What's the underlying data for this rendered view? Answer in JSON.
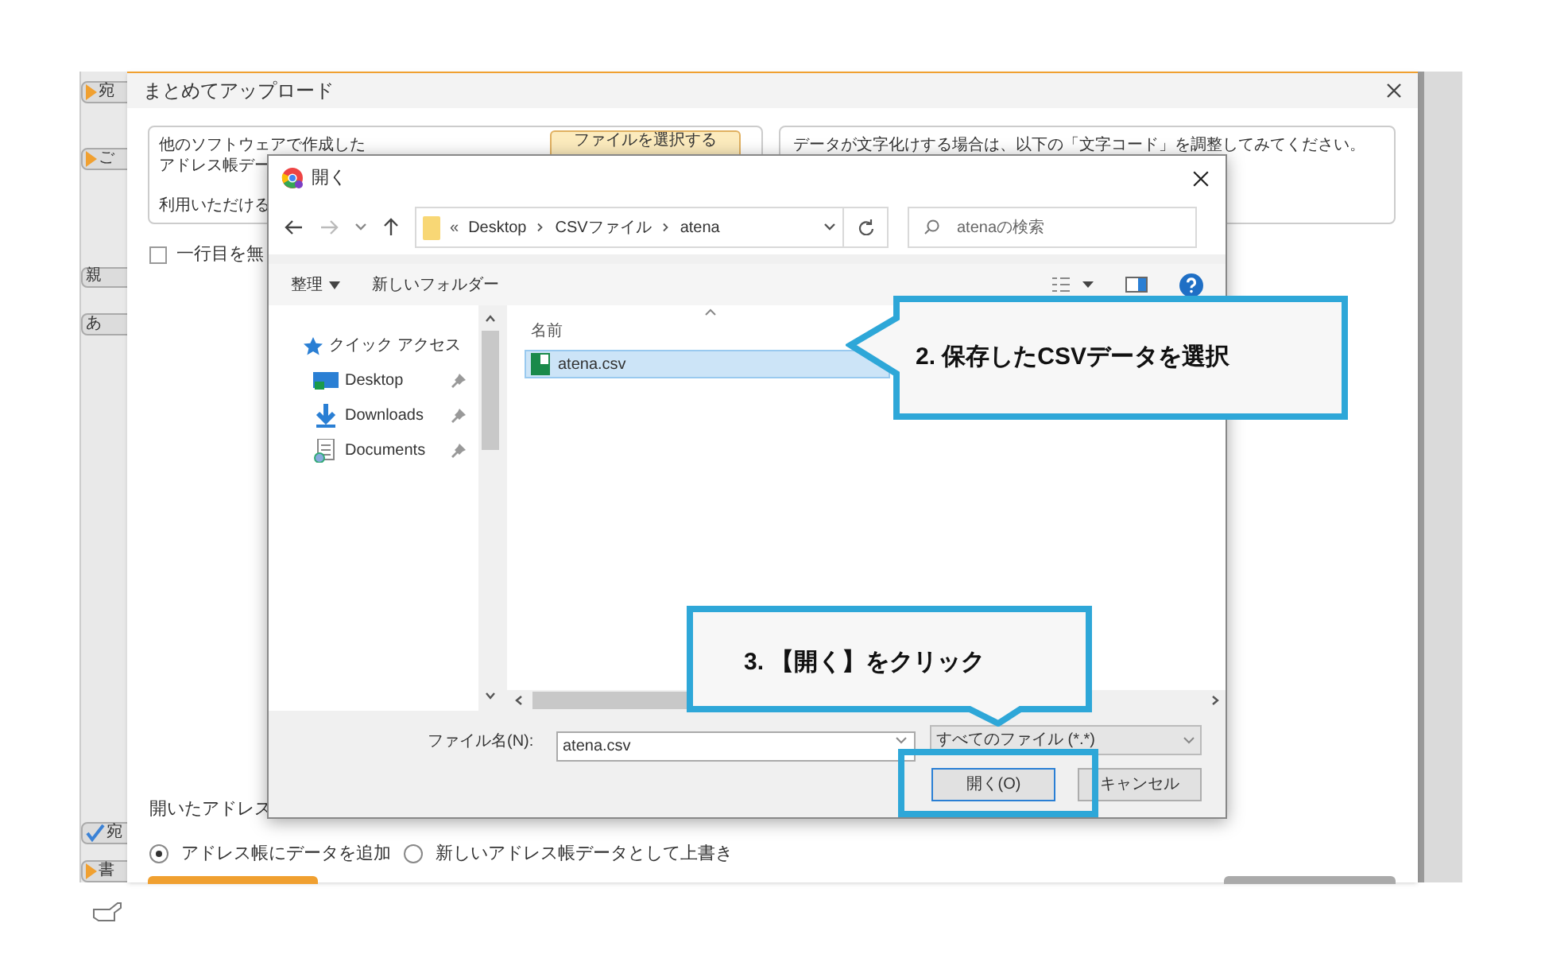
{
  "app_sidebar": {
    "items": [
      {
        "kind": "arrow",
        "label": "宛"
      },
      {
        "kind": "arrow",
        "label": "ご"
      },
      {
        "kind": "plain",
        "label": "親"
      },
      {
        "kind": "plain",
        "label": "あ"
      },
      {
        "kind": "check",
        "label": "宛"
      },
      {
        "kind": "arrow",
        "label": "書"
      }
    ]
  },
  "upload_dialog": {
    "title": "まとめてアップロード",
    "file_box": {
      "lines": [
        "他のソフトウェアで作成した",
        "アドレス帳デー",
        "利用いただける"
      ],
      "button": "ファイルを選択する"
    },
    "encoding_note": "データが文字化けする場合は、以下の「文字コード」を調整してみてください。",
    "skip_first_row": {
      "label": "一行目を無",
      "checked": false
    },
    "open_mode_label": "開いたアドレス",
    "open_mode_options": [
      {
        "label": "アドレス帳にデータを追加",
        "selected": true
      },
      {
        "label": "新しいアドレス帳データとして上書き",
        "selected": false
      }
    ]
  },
  "file_dialog": {
    "title": "開く",
    "path": {
      "prefix": "«",
      "parts": [
        "Desktop",
        "CSVファイル",
        "atena"
      ]
    },
    "search": {
      "placeholder": "atenaの検索"
    },
    "toolbar": [
      "整理",
      "新しいフォルダー"
    ],
    "nav": {
      "heading": "クイック アクセス",
      "items": [
        {
          "kind": "desktop",
          "label": "Desktop",
          "pinned": true
        },
        {
          "kind": "downloads",
          "label": "Downloads",
          "pinned": true
        },
        {
          "kind": "documents",
          "label": "Documents",
          "pinned": true
        }
      ]
    },
    "column": "名前",
    "files": [
      {
        "name": "atena.csv",
        "selected": true
      }
    ],
    "filename_label": "ファイル名(N):",
    "filename": "atena.csv",
    "filetype": "すべてのファイル (*.*)",
    "buttons": [
      "開く(O)",
      "キャンセル"
    ]
  },
  "callouts": [
    {
      "kind": "left",
      "text": "2. 保存したCSVデータを選択"
    },
    {
      "kind": "down",
      "text": "3. 【開く】をクリック"
    }
  ]
}
